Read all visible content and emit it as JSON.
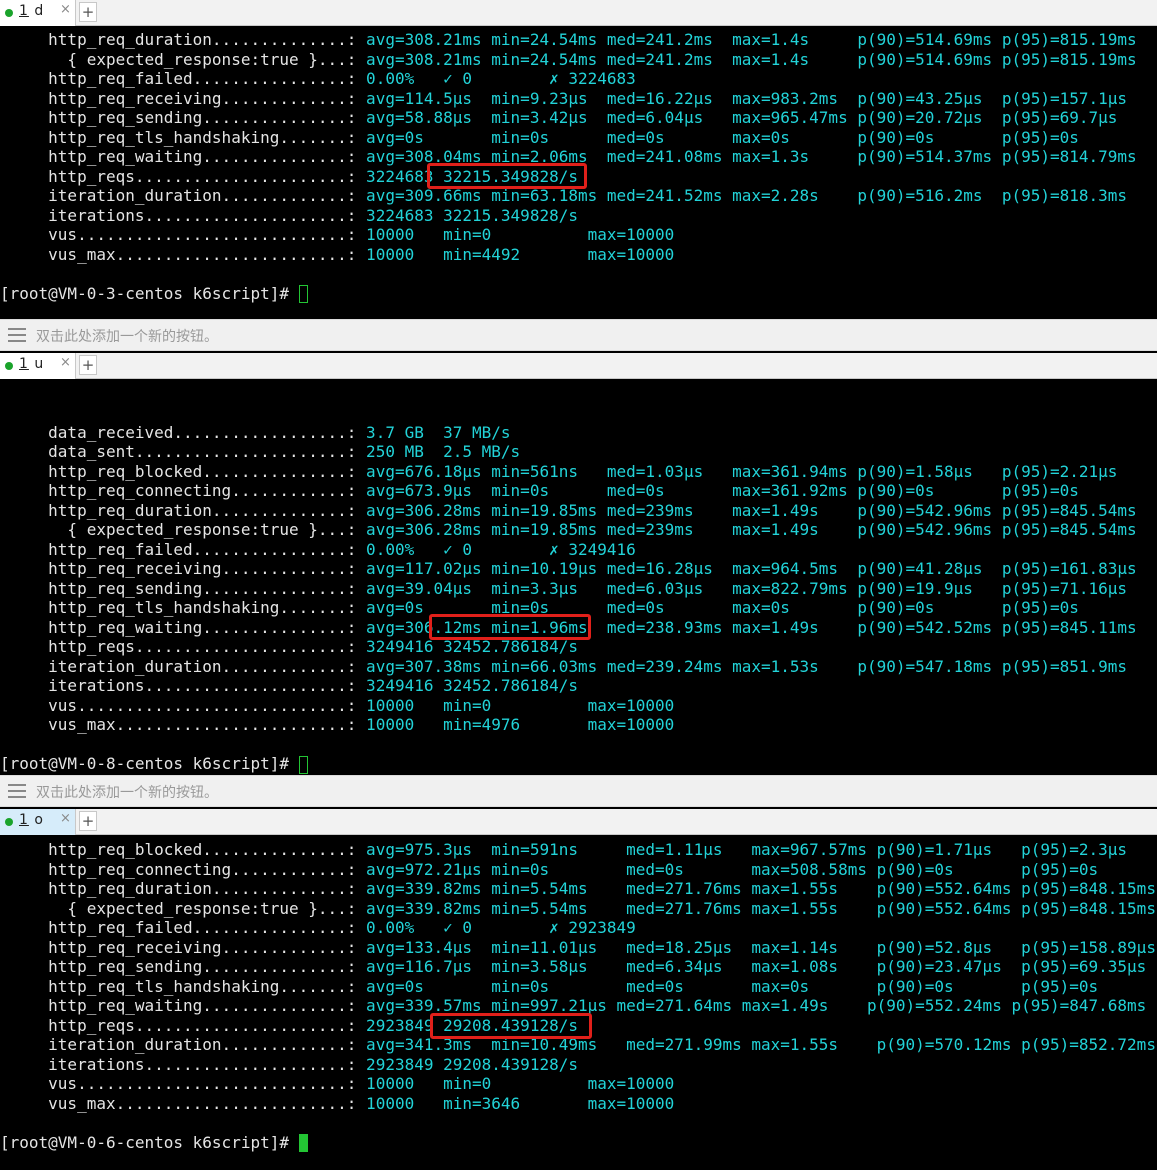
{
  "add_button_hint": "双击此处添加一个新的按钮。",
  "panes": [
    {
      "tab": {
        "num": "1",
        "name": "d",
        "close": "×",
        "new": "+"
      },
      "lines": [
        {
          "n": "     http_req_duration..............:",
          "c": " avg=308.21ms min=24.54ms med=241.2ms  max=1.4s     p(90)=514.69ms p(95)=815.19ms"
        },
        {
          "n": "       { expected_response:true }...:",
          "c": " avg=308.21ms min=24.54ms med=241.2ms  max=1.4s     p(90)=514.69ms p(95)=815.19ms"
        },
        {
          "n": "     http_req_failed................:",
          "c": " 0.00%   ✓ 0        ✗ 3224683"
        },
        {
          "n": "     http_req_receiving.............:",
          "c": " avg=114.5µs  min=9.23µs  med=16.22µs  max=983.2ms  p(90)=43.25µs  p(95)=157.1µs"
        },
        {
          "n": "     http_req_sending...............:",
          "c": " avg=58.88µs  min=3.42µs  med=6.04µs   max=965.47ms p(90)=20.72µs  p(95)=69.7µs"
        },
        {
          "n": "     http_req_tls_handshaking.......:",
          "c": " avg=0s       min=0s      med=0s       max=0s       p(90)=0s       p(95)=0s"
        },
        {
          "n": "     http_req_waiting...............:",
          "c": " avg=308.04ms min=2.06ms  med=241.08ms max=1.3s     p(90)=514.37ms p(95)=814.79ms"
        },
        {
          "n": "     http_reqs......................:",
          "c": " 3224683 32215.349828/s"
        },
        {
          "n": "     iteration_duration.............:",
          "c": " avg=309.66ms min=63.18ms med=241.52ms max=2.28s    p(90)=516.2ms  p(95)=818.3ms"
        },
        {
          "n": "     iterations.....................:",
          "c": " 3224683 32215.349828/s"
        },
        {
          "n": "     vus............................:",
          "c": " 10000   min=0          max=10000"
        },
        {
          "n": "     vus_max........................:",
          "c": " 10000   min=4492       max=10000"
        },
        {
          "n": "",
          "c": ""
        },
        {
          "n": "[root@VM-0-3-centos k6script]# ",
          "c": ""
        }
      ]
    },
    {
      "tab": {
        "num": "1",
        "name": "u",
        "close": "×",
        "new": "+"
      },
      "lines": [
        {
          "n": "",
          "c": ""
        },
        {
          "n": "     data_received..................:",
          "c": " 3.7 GB  37 MB/s"
        },
        {
          "n": "     data_sent......................:",
          "c": " 250 MB  2.5 MB/s"
        },
        {
          "n": "     http_req_blocked...............:",
          "c": " avg=676.18µs min=561ns   med=1.03µs   max=361.94ms p(90)=1.58µs   p(95)=2.21µs"
        },
        {
          "n": "     http_req_connecting............:",
          "c": " avg=673.9µs  min=0s      med=0s       max=361.92ms p(90)=0s       p(95)=0s"
        },
        {
          "n": "     http_req_duration..............:",
          "c": " avg=306.28ms min=19.85ms med=239ms    max=1.49s    p(90)=542.96ms p(95)=845.54ms"
        },
        {
          "n": "       { expected_response:true }...:",
          "c": " avg=306.28ms min=19.85ms med=239ms    max=1.49s    p(90)=542.96ms p(95)=845.54ms"
        },
        {
          "n": "     http_req_failed................:",
          "c": " 0.00%   ✓ 0        ✗ 3249416"
        },
        {
          "n": "     http_req_receiving.............:",
          "c": " avg=117.02µs min=10.19µs med=16.28µs  max=964.5ms  p(90)=41.28µs  p(95)=161.83µs"
        },
        {
          "n": "     http_req_sending...............:",
          "c": " avg=39.04µs  min=3.3µs   med=6.03µs   max=822.79ms p(90)=19.9µs   p(95)=71.16µs"
        },
        {
          "n": "     http_req_tls_handshaking.......:",
          "c": " avg=0s       min=0s      med=0s       max=0s       p(90)=0s       p(95)=0s"
        },
        {
          "n": "     http_req_waiting...............:",
          "c": " avg=306.12ms min=1.96ms  med=238.93ms max=1.49s    p(90)=542.52ms p(95)=845.11ms"
        },
        {
          "n": "     http_reqs......................:",
          "c": " 3249416 32452.786184/s"
        },
        {
          "n": "     iteration_duration.............:",
          "c": " avg=307.38ms min=66.03ms med=239.24ms max=1.53s    p(90)=547.18ms p(95)=851.9ms"
        },
        {
          "n": "     iterations.....................:",
          "c": " 3249416 32452.786184/s"
        },
        {
          "n": "     vus............................:",
          "c": " 10000   min=0          max=10000"
        },
        {
          "n": "     vus_max........................:",
          "c": " 10000   min=4976       max=10000"
        },
        {
          "n": "",
          "c": ""
        },
        {
          "n": "[root@VM-0-8-centos k6script]# ",
          "c": ""
        }
      ]
    },
    {
      "tab": {
        "num": "1",
        "name": "o",
        "close": "×",
        "new": "+"
      },
      "lines": [
        {
          "n": "     http_req_blocked...............:",
          "c": " avg=975.3µs  min=591ns     med=1.11µs   max=967.57ms p(90)=1.71µs   p(95)=2.3µs"
        },
        {
          "n": "     http_req_connecting............:",
          "c": " avg=972.21µs min=0s        med=0s       max=508.58ms p(90)=0s       p(95)=0s"
        },
        {
          "n": "     http_req_duration..............:",
          "c": " avg=339.82ms min=5.54ms    med=271.76ms max=1.55s    p(90)=552.64ms p(95)=848.15ms"
        },
        {
          "n": "       { expected_response:true }...:",
          "c": " avg=339.82ms min=5.54ms    med=271.76ms max=1.55s    p(90)=552.64ms p(95)=848.15ms"
        },
        {
          "n": "     http_req_failed................:",
          "c": " 0.00%   ✓ 0        ✗ 2923849"
        },
        {
          "n": "     http_req_receiving.............:",
          "c": " avg=133.4µs  min=11.01µs   med=18.25µs  max=1.14s    p(90)=52.8µs   p(95)=158.89µs"
        },
        {
          "n": "     http_req_sending...............:",
          "c": " avg=116.7µs  min=3.58µs    med=6.34µs   max=1.08s    p(90)=23.47µs  p(95)=69.35µs"
        },
        {
          "n": "     http_req_tls_handshaking.......:",
          "c": " avg=0s       min=0s        med=0s       max=0s       p(90)=0s       p(95)=0s"
        },
        {
          "n": "     http_req_waiting...............:",
          "c": " avg=339.57ms min=997.21µs med=271.64ms max=1.49s    p(90)=552.24ms p(95)=847.68ms"
        },
        {
          "n": "     http_reqs......................:",
          "c": " 2923849 29208.439128/s"
        },
        {
          "n": "     iteration_duration.............:",
          "c": " avg=341.3ms  min=10.49ms   med=271.99ms max=1.55s    p(90)=570.12ms p(95)=852.72ms"
        },
        {
          "n": "     iterations.....................:",
          "c": " 2923849 29208.439128/s"
        },
        {
          "n": "     vus............................:",
          "c": " 10000   min=0          max=10000"
        },
        {
          "n": "     vus_max........................:",
          "c": " 10000   min=3646       max=10000"
        },
        {
          "n": "",
          "c": ""
        },
        {
          "n": "[root@VM-0-6-centos k6script]# ",
          "c": ""
        }
      ]
    }
  ],
  "colors": {
    "value_text": "#22d3d8",
    "label_text": "#e5e5e5",
    "highlight": "#e0201a",
    "cursor": "#23c534"
  }
}
